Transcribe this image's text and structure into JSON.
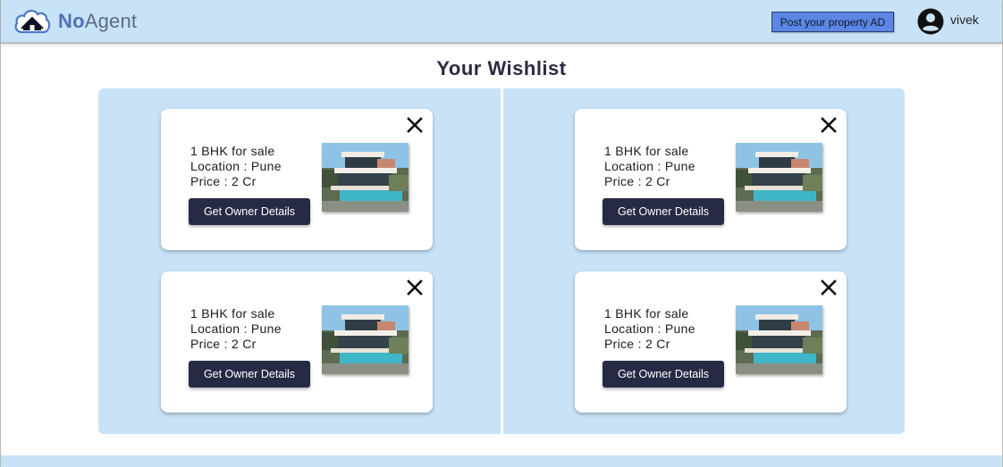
{
  "header": {
    "logo": {
      "text_strong": "No",
      "text_light": "Agent",
      "icon": "cloud-house-icon"
    },
    "post_ad_label": "Post your property AD",
    "user": {
      "name": "vivek",
      "icon": "user-circle-icon"
    }
  },
  "page_title": "Your Wishlist",
  "wishlist": {
    "cards": [
      {
        "line1": "1 BHK for sale",
        "line2": "Location : Pune",
        "line3": "Price : 2 Cr",
        "button_label": "Get Owner Details",
        "close_icon": "close-icon",
        "image": "villa-photo"
      },
      {
        "line1": "1 BHK for sale",
        "line2": "Location : Pune",
        "line3": "Price : 2 Cr",
        "button_label": "Get Owner Details",
        "close_icon": "close-icon",
        "image": "villa-photo"
      },
      {
        "line1": "1 BHK for sale",
        "line2": "Location : Pune",
        "line3": "Price : 2 Cr",
        "button_label": "Get Owner Details",
        "close_icon": "close-icon",
        "image": "villa-photo"
      },
      {
        "line1": "1 BHK for sale",
        "line2": "Location : Pune",
        "line3": "Price : 2 Cr",
        "button_label": "Get Owner Details",
        "close_icon": "close-icon",
        "image": "villa-photo"
      }
    ]
  },
  "colors": {
    "header_bg": "#c8e3f8",
    "panel_bg": "#c8e3f8",
    "button_dark": "#272a45",
    "post_ad_bg": "#5b86e5",
    "logo_blue": "#4f72b8"
  }
}
